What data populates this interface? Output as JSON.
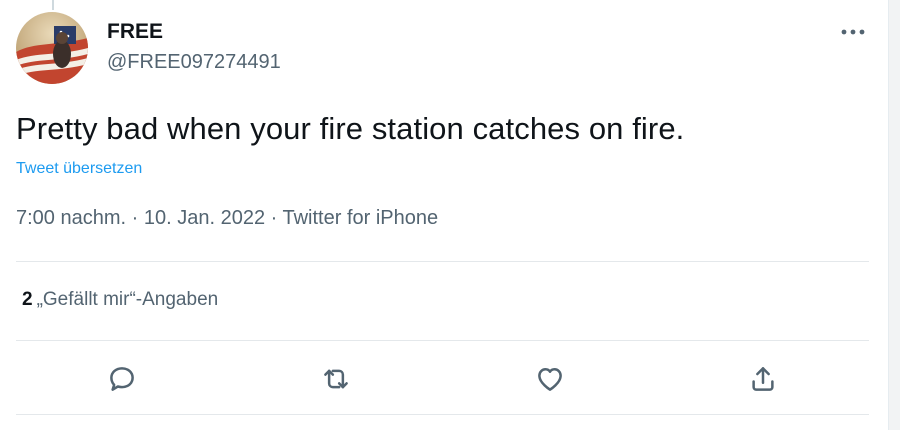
{
  "tweet": {
    "display_name": "FREE",
    "handle": "@FREE097274491",
    "text": "Pretty bad when your fire station catches on fire.",
    "translate_label": "Tweet übersetzen",
    "time": "7:00 nachm.",
    "separator": " · ",
    "date": "10. Jan. 2022",
    "source": "Twitter for iPhone",
    "likes_count": "2",
    "likes_label": "„Gefällt mir“-Angaben"
  },
  "icons": {
    "more": "more-horizontal-icon",
    "reply": "reply-bubble-icon",
    "retweet": "retweet-icon",
    "like": "heart-icon",
    "share": "share-upload-icon"
  },
  "colors": {
    "text_primary": "#0f1419",
    "text_secondary": "#536471",
    "link": "#1d9bf0",
    "divider": "#e4e8eb"
  }
}
